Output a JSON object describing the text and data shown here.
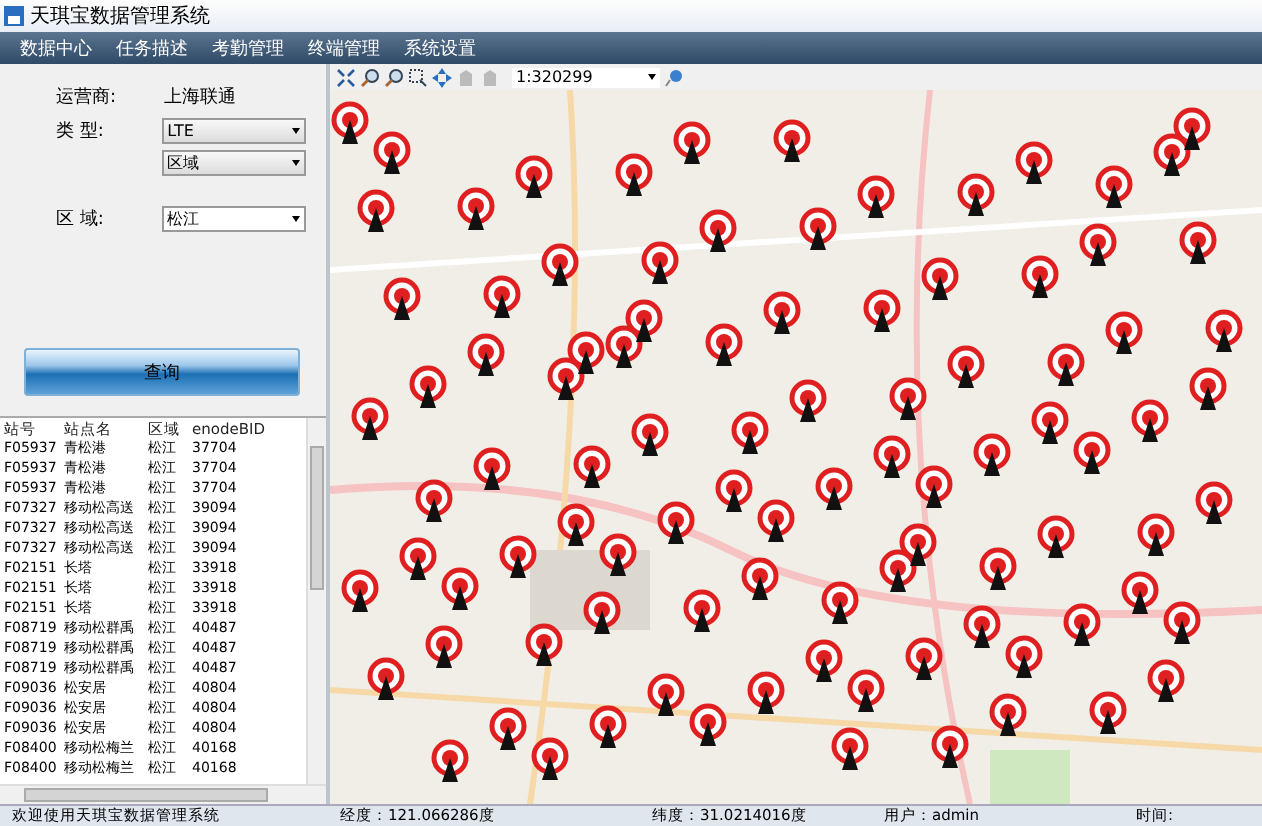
{
  "window": {
    "title": "天琪宝数据管理系统"
  },
  "menu": [
    "数据中心",
    "任务描述",
    "考勤管理",
    "终端管理",
    "系统设置"
  ],
  "query": {
    "operator_label": "运营商:",
    "operator_value": "上海联通",
    "type_label": "类 型:",
    "type_value": "LTE",
    "subtype_value": "区域",
    "area_label": "区 域:",
    "area_value": "松江",
    "button": "查询"
  },
  "table": {
    "columns": [
      "站号",
      "站点名",
      "区域",
      "enodeBID"
    ],
    "rows": [
      [
        "F05937",
        "青松港",
        "松江",
        "37704"
      ],
      [
        "F05937",
        "青松港",
        "松江",
        "37704"
      ],
      [
        "F05937",
        "青松港",
        "松江",
        "37704"
      ],
      [
        "F07327",
        "移动松高送",
        "松江",
        "39094"
      ],
      [
        "F07327",
        "移动松高送",
        "松江",
        "39094"
      ],
      [
        "F07327",
        "移动松高送",
        "松江",
        "39094"
      ],
      [
        "F02151",
        "长塔",
        "松江",
        "33918"
      ],
      [
        "F02151",
        "长塔",
        "松江",
        "33918"
      ],
      [
        "F02151",
        "长塔",
        "松江",
        "33918"
      ],
      [
        "F08719",
        "移动松群禹",
        "松江",
        "40487"
      ],
      [
        "F08719",
        "移动松群禹",
        "松江",
        "40487"
      ],
      [
        "F08719",
        "移动松群禹",
        "松江",
        "40487"
      ],
      [
        "F09036",
        "松安居",
        "松江",
        "40804"
      ],
      [
        "F09036",
        "松安居",
        "松江",
        "40804"
      ],
      [
        "F09036",
        "松安居",
        "松江",
        "40804"
      ],
      [
        "F08400",
        "移动松梅兰",
        "松江",
        "40168"
      ],
      [
        "F08400",
        "移动松梅兰",
        "松江",
        "40168"
      ]
    ]
  },
  "map_toolbar": {
    "scale": "1:320299"
  },
  "status_bar": {
    "welcome": "欢迎使用天琪宝数据管理系统",
    "longitude": "经度：121.066286度",
    "latitude": "纬度：31.0214016度",
    "user": "用户：admin",
    "time": "时间:"
  }
}
